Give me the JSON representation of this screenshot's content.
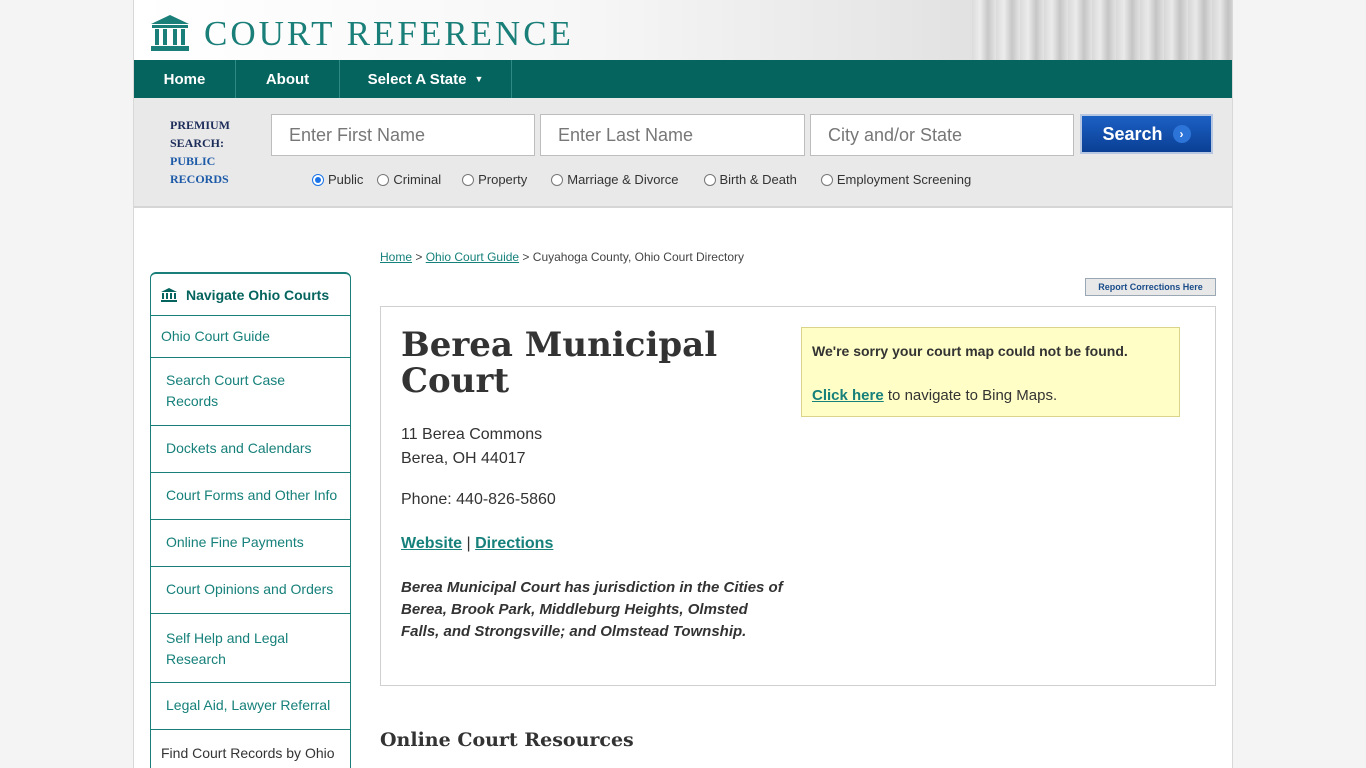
{
  "header": {
    "logo_text": "COURT REFERENCE",
    "nav": {
      "home": "Home",
      "about": "About",
      "select_state": "Select A State"
    }
  },
  "search": {
    "premium_line1": "PREMIUM",
    "premium_line2": "SEARCH:",
    "premium_line3": "PUBLIC",
    "premium_line4": "RECORDS",
    "first_name_placeholder": "Enter First Name",
    "last_name_placeholder": "Enter Last Name",
    "city_placeholder": "City and/or State",
    "button_label": "Search",
    "radio_options": [
      {
        "label": "Public",
        "selected": true
      },
      {
        "label": "Criminal",
        "selected": false
      },
      {
        "label": "Property",
        "selected": false
      },
      {
        "label": "Marriage & Divorce",
        "selected": false
      },
      {
        "label": "Birth & Death",
        "selected": false
      },
      {
        "label": "Employment Screening",
        "selected": false
      }
    ]
  },
  "sidebar": {
    "title": "Navigate Ohio Courts",
    "items": [
      {
        "label": "Ohio Court Guide"
      },
      {
        "label": "Search Court Case Records"
      },
      {
        "label": "Dockets and Calendars"
      },
      {
        "label": "Court Forms and Other Info"
      },
      {
        "label": "Online Fine Payments"
      },
      {
        "label": "Court Opinions and Orders"
      },
      {
        "label": "Self Help and Legal Research"
      },
      {
        "label": "Legal Aid, Lawyer Referral"
      }
    ],
    "footer_text": "Find Court Records by Ohio County:"
  },
  "breadcrumb": {
    "home": "Home",
    "sep1": " > ",
    "guide": "Ohio Court Guide",
    "sep2": " > ",
    "current": "Cuyahoga County, Ohio Court Directory"
  },
  "report_button": "Report Corrections Here",
  "court": {
    "name": "Berea Municipal Court",
    "address_line1": "11 Berea Commons",
    "address_line2": "Berea, OH 44017",
    "phone": "Phone: 440-826-5860",
    "website_link": "Website",
    "link_separator": " | ",
    "directions_link": "Directions",
    "description": "Berea Municipal Court has jurisdiction in the Cities of Berea, Brook Park, Middleburg Heights, Olmsted Falls, and Strongsville; and Olmstead Township."
  },
  "map_notice": {
    "message": "We're sorry your court map could not be found.",
    "link": "Click here",
    "suffix": " to navigate to Bing Maps."
  },
  "resources_heading": "Online Court Resources",
  "colors": {
    "brand_teal": "#06645e",
    "link_teal": "#16807a",
    "search_blue": "#0a3f94",
    "notice_yellow": "#fefec6"
  }
}
